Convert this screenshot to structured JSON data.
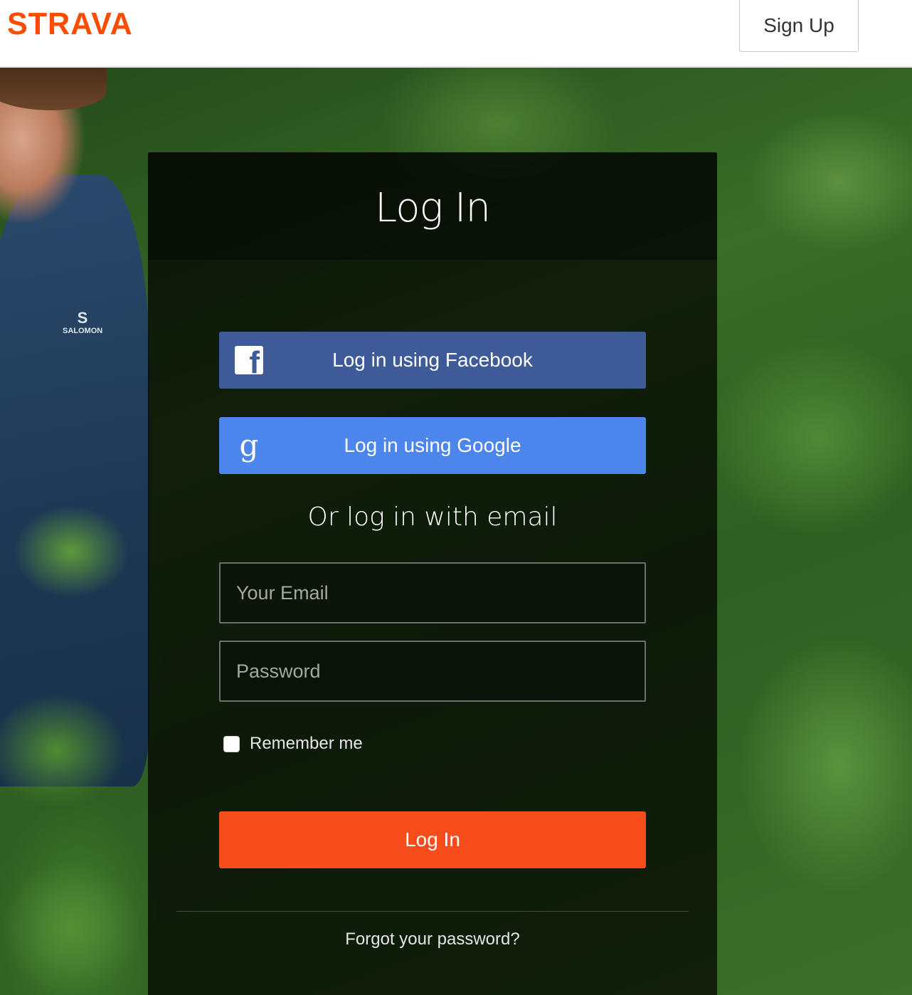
{
  "header": {
    "logo_text": "STRAVA",
    "brand_color": "#fc4c02",
    "signup_label": "Sign Up"
  },
  "hero": {
    "jacket_brand": "SALOMON",
    "jacket_logo_letter": "S"
  },
  "login_panel": {
    "title": "Log In",
    "facebook_button": {
      "label": "Log in using Facebook",
      "icon": "facebook-icon",
      "icon_glyph": "f",
      "color": "#3e5a98"
    },
    "google_button": {
      "label": "Log in using Google",
      "icon": "google-icon",
      "icon_glyph": "g",
      "color": "#4c86ec"
    },
    "email_divider_text": "Or log in with email",
    "email_field": {
      "placeholder": "Your Email",
      "value": ""
    },
    "password_field": {
      "placeholder": "Password",
      "value": ""
    },
    "remember_me": {
      "label": "Remember me",
      "checked": false
    },
    "submit_button": {
      "label": "Log In",
      "color": "#f74d1c"
    },
    "forgot_password_link": "Forgot your password?"
  }
}
